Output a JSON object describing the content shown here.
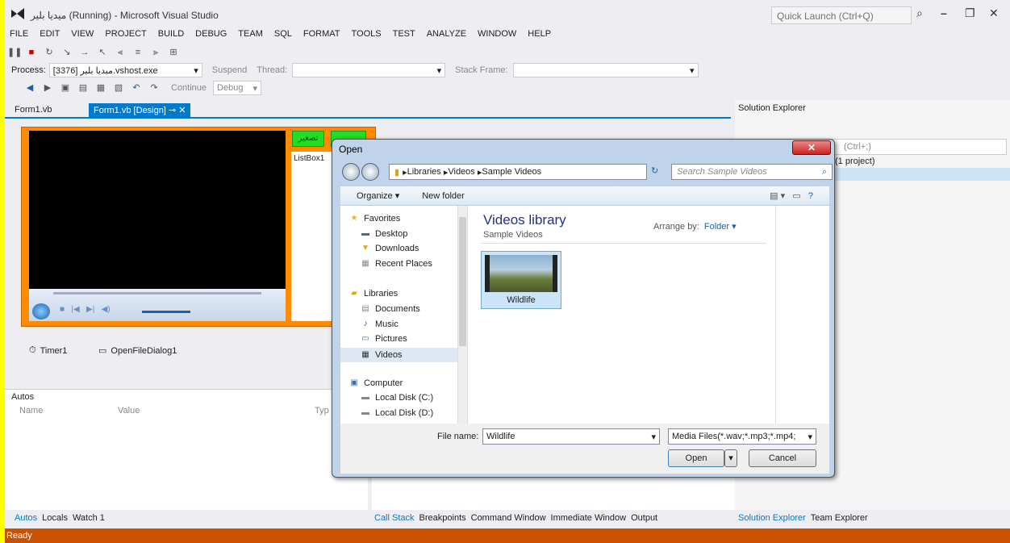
{
  "window": {
    "title": "ميديا بلير (Running) - Microsoft Visual Studio",
    "quick_launch": "Quick Launch (Ctrl+Q)"
  },
  "menu": [
    "FILE",
    "EDIT",
    "VIEW",
    "PROJECT",
    "BUILD",
    "DEBUG",
    "TEAM",
    "SQL",
    "FORMAT",
    "TOOLS",
    "TEST",
    "ANALYZE",
    "WINDOW",
    "HELP"
  ],
  "debug_bar": {
    "process_label": "Process:",
    "process_value": "[3376] ميديا بلير.vshost.exe",
    "suspend": "Suspend",
    "thread": "Thread:",
    "stack_frame": "Stack Frame:"
  },
  "std_bar": {
    "continue": "Continue",
    "config": "Debug"
  },
  "tabs": [
    "Form1.vb",
    "Form1.vb [Design]"
  ],
  "form": {
    "btn1": "تصغير",
    "btn2": "",
    "listbox": "ListBox1"
  },
  "tray": {
    "timer": "Timer1",
    "ofd": "OpenFileDialog1"
  },
  "autos": {
    "title": "Autos",
    "col_name": "Name",
    "col_value": "Value",
    "col_type": "Typ"
  },
  "bottom_left_tabs": [
    "Autos",
    "Locals",
    "Watch 1"
  ],
  "bottom_mid_tabs": [
    "Call Stack",
    "Breakpoints",
    "Command Window",
    "Immediate Window",
    "Output"
  ],
  "bottom_right_tabs": [
    "Solution Explorer",
    "Team Explorer"
  ],
  "solution_explorer": {
    "title": "Solution Explorer",
    "search_hint": "(Ctrl+;)",
    "project_info": "(1 project)"
  },
  "status": "Ready",
  "dialog": {
    "title": "Open",
    "breadcrumb": [
      "Libraries",
      "Videos",
      "Sample Videos"
    ],
    "search_placeholder": "Search Sample Videos",
    "organize": "Organize",
    "new_folder": "New folder",
    "nav": {
      "favorites": "Favorites",
      "desktop": "Desktop",
      "downloads": "Downloads",
      "recent": "Recent Places",
      "libraries": "Libraries",
      "documents": "Documents",
      "music": "Music",
      "pictures": "Pictures",
      "videos": "Videos",
      "computer": "Computer",
      "disk_c": "Local Disk (C:)",
      "disk_d": "Local Disk (D:)"
    },
    "library_title": "Videos library",
    "library_sub": "Sample Videos",
    "arrange_label": "Arrange by:",
    "arrange_value": "Folder",
    "file_item": "Wildlife",
    "file_name_label": "File name:",
    "file_name_value": "Wildlife",
    "filter": "Media Files(*.wav;*.mp3;*.mp4;",
    "open": "Open",
    "cancel": "Cancel"
  }
}
